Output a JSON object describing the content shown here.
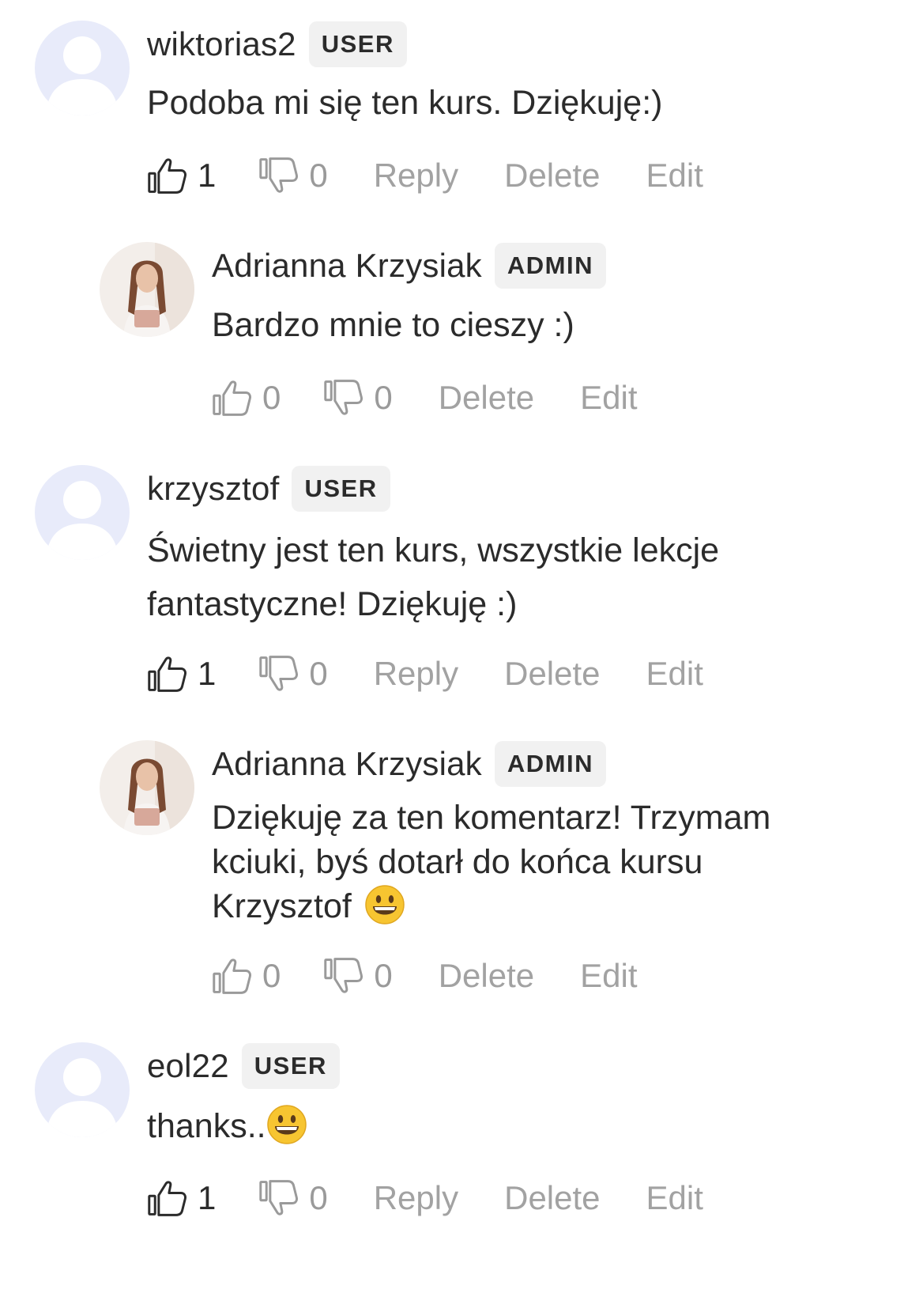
{
  "badges": {
    "user": "USER",
    "admin": "ADMIN"
  },
  "actions": {
    "reply": "Reply",
    "delete": "Delete",
    "edit": "Edit"
  },
  "comments": [
    {
      "author": "wiktorias2",
      "role": "USER",
      "text": "Podoba mi się ten kurs. Dziękuję:)",
      "likes": "1",
      "dislikes": "0"
    },
    {
      "author": "Adrianna Krzysiak",
      "role": "ADMIN",
      "text": "Bardzo mnie to cieszy :)",
      "likes": "0",
      "dislikes": "0"
    },
    {
      "author": "krzysztof",
      "role": "USER",
      "text_line1": "Świetny jest ten kurs, wszystkie lekcje",
      "text_line2": "fantastyczne! Dziękuję :)",
      "likes": "1",
      "dislikes": "0"
    },
    {
      "author": "Adrianna Krzysiak",
      "role": "ADMIN",
      "text_line1": "Dziękuję za ten komentarz! Trzymam",
      "text_line2": "kciuki, byś dotarł do końca kursu",
      "text_line3": "Krzysztof",
      "emoji": "grinning-face",
      "likes": "0",
      "dislikes": "0"
    },
    {
      "author": "eol22",
      "role": "USER",
      "text": "thanks..",
      "emoji": "grinning-face",
      "likes": "1",
      "dislikes": "0"
    }
  ],
  "icons": {
    "like": "thumbs-up-icon",
    "dislike": "thumbs-down-icon",
    "user_avatar": "default-avatar-icon",
    "admin_avatar": "admin-photo-avatar"
  },
  "colors": {
    "text": "#2b2b2b",
    "muted": "#a2a2a2",
    "badge_bg": "#f1f1f1",
    "avatar_bg": "#e8ebfa"
  }
}
